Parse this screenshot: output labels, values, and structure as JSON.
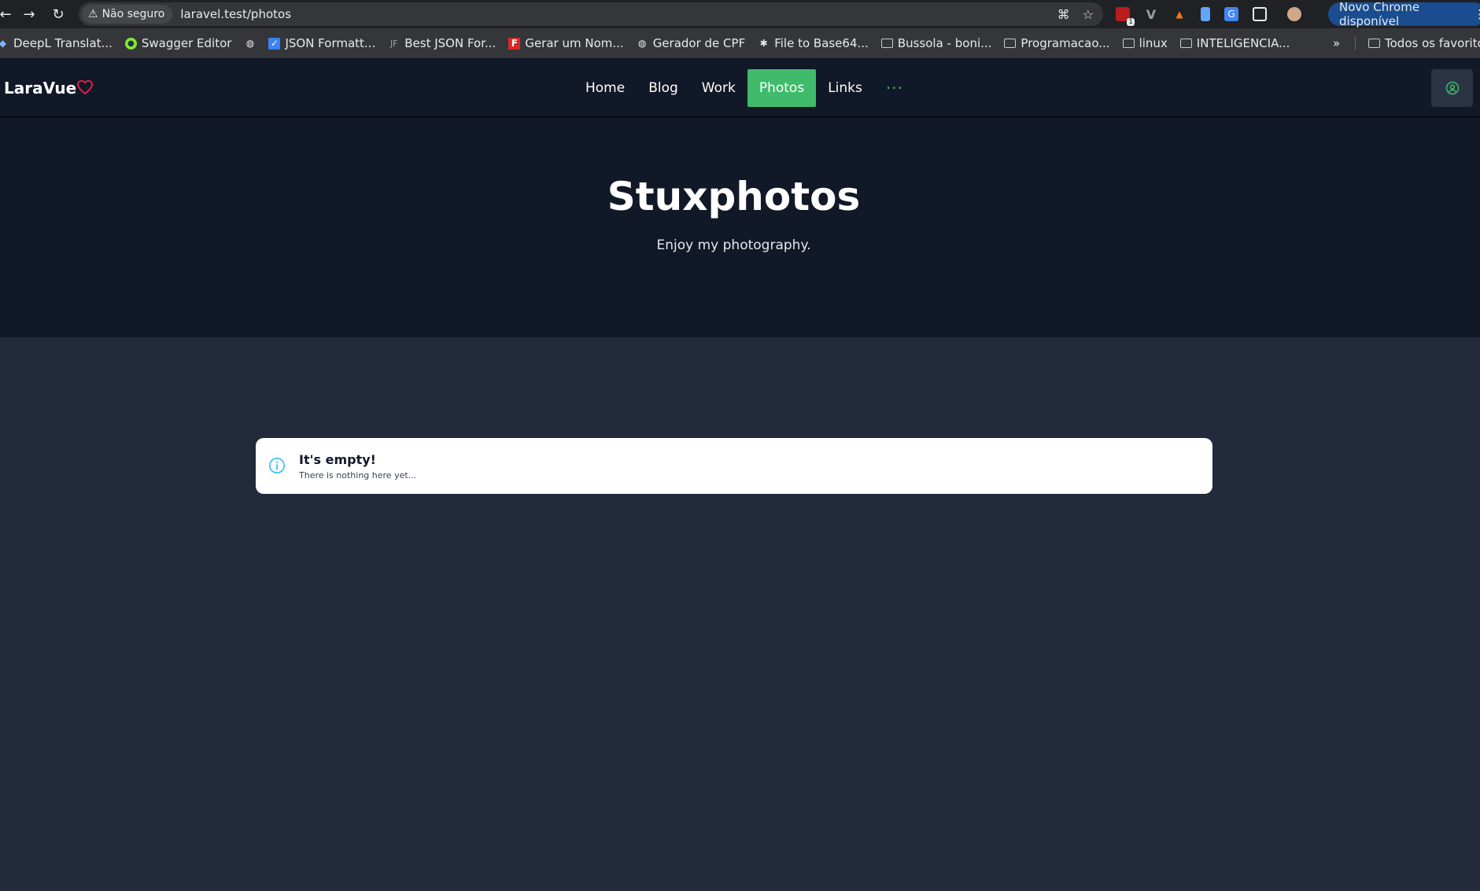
{
  "browser": {
    "security_label": "Não seguro",
    "url": "laravel.test/photos",
    "update_label": "Novo Chrome disponível",
    "extension_badge": "1"
  },
  "bookmarks": {
    "items": [
      {
        "label": "DeepL Translat...",
        "icon": "deepl-icon"
      },
      {
        "label": "Swagger Editor",
        "icon": "swagger-icon"
      },
      {
        "label": "",
        "icon": "globe-icon"
      },
      {
        "label": "JSON Formatt...",
        "icon": "checkbox-icon"
      },
      {
        "label": "Best JSON For...",
        "icon": "jf-icon"
      },
      {
        "label": "Gerar um Nom...",
        "icon": "f-icon"
      },
      {
        "label": "Gerador de CPF",
        "icon": "globe-icon"
      },
      {
        "label": "File to Base64...",
        "icon": "bug-icon"
      },
      {
        "label": "Bussola - boni...",
        "icon": "folder-icon"
      },
      {
        "label": "Programacao...",
        "icon": "folder-icon"
      },
      {
        "label": "linux",
        "icon": "folder-icon"
      },
      {
        "label": "INTELIGENCIA...",
        "icon": "folder-icon"
      }
    ],
    "overflow": "»",
    "all_bookmarks": "Todos os favoritos"
  },
  "nav": {
    "brand": "LaraVue",
    "items": [
      "Home",
      "Blog",
      "Work",
      "Photos",
      "Links"
    ],
    "active": "Photos",
    "more": "···"
  },
  "hero": {
    "title": "Stuxphotos",
    "subtitle": "Enjoy my photography."
  },
  "empty_state": {
    "title": "It's empty!",
    "message": "There is nothing here yet..."
  },
  "colors": {
    "accent": "#3fbb6b",
    "heart": "#e11d48",
    "info": "#38bdf8",
    "page_bg": "#222a3b",
    "header_bg": "#111827"
  }
}
